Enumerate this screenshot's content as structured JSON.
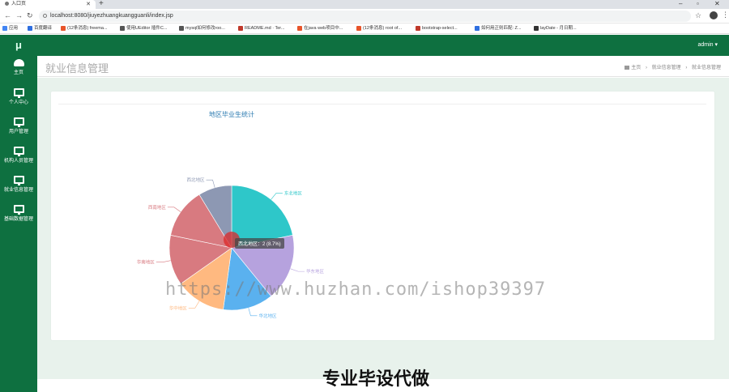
{
  "browser": {
    "tab_title": "入口页",
    "url": "localhost:8080/jiuyezhuangkuangguanli/index.jsp",
    "bookmarks": [
      {
        "label": "应用",
        "color": "#4285f4"
      },
      {
        "label": "百度翻译",
        "color": "#2f6fe0"
      },
      {
        "label": "(12条消息) freema...",
        "color": "#e8542a"
      },
      {
        "label": "使用UEditor 插件C...",
        "color": "#555555"
      },
      {
        "label": "mysql如何修改roo...",
        "color": "#555555"
      },
      {
        "label": "README.md · Ter...",
        "color": "#c0392b"
      },
      {
        "label": "在java web项目中...",
        "color": "#e8542a"
      },
      {
        "label": "(12条消息) root of...",
        "color": "#e8542a"
      },
      {
        "label": "bootstrap-select...",
        "color": "#c0392b"
      },
      {
        "label": "如何用正则匹配: Z...",
        "color": "#2f6fe0"
      },
      {
        "label": "layDate - 月日期...",
        "color": "#333333"
      }
    ]
  },
  "app": {
    "logo": "μ",
    "user_menu": "admin ▾",
    "sidebar": [
      {
        "label": "主页",
        "icon": "dashboard-icon"
      },
      {
        "label": "个人中心",
        "icon": "monitor-icon"
      },
      {
        "label": "用户管理",
        "icon": "monitor-icon"
      },
      {
        "label": "机构人员管理",
        "icon": "monitor-icon"
      },
      {
        "label": "就业信息管理",
        "icon": "monitor-icon"
      },
      {
        "label": "基础数据管理",
        "icon": "monitor-icon"
      }
    ],
    "page_title": "就业信息管理",
    "breadcrumb": [
      "主页",
      "就业信息管理",
      "就业信息管理"
    ],
    "breadcrumb_sep": "›"
  },
  "chart_data": {
    "type": "pie",
    "title": "地区毕业生统计",
    "slices": [
      {
        "name": "东北地区",
        "value": 5,
        "color": "#2ec7c9"
      },
      {
        "name": "华东地区",
        "value": 4,
        "color": "#b6a2de"
      },
      {
        "name": "华北地区",
        "value": 3,
        "color": "#5ab1ef"
      },
      {
        "name": "华中地区",
        "value": 3,
        "color": "#ffb980"
      },
      {
        "name": "华南地区",
        "value": 3,
        "color": "#d87a80"
      },
      {
        "name": "西南地区",
        "value": 3,
        "color": "#d87a80"
      },
      {
        "name": "西北地区",
        "value": 2,
        "color": "#8d98b3"
      }
    ],
    "tooltip": "西北地区：2 (8.7%)"
  },
  "watermark": "https://www.huzhan.com/ishop39397",
  "promo_text": "专业毕设代做"
}
